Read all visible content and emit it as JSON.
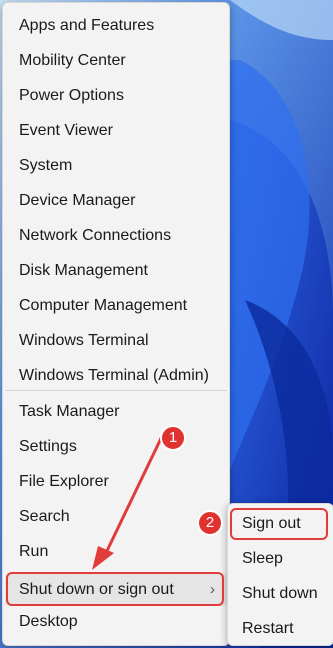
{
  "menu": {
    "items_group1": [
      {
        "name": "menu-item-apps-and-features",
        "label": "Apps and Features"
      },
      {
        "name": "menu-item-mobility-center",
        "label": "Mobility Center"
      },
      {
        "name": "menu-item-power-options",
        "label": "Power Options"
      },
      {
        "name": "menu-item-event-viewer",
        "label": "Event Viewer"
      },
      {
        "name": "menu-item-system",
        "label": "System"
      },
      {
        "name": "menu-item-device-manager",
        "label": "Device Manager"
      },
      {
        "name": "menu-item-network-connections",
        "label": "Network Connections"
      },
      {
        "name": "menu-item-disk-management",
        "label": "Disk Management"
      },
      {
        "name": "menu-item-computer-management",
        "label": "Computer Management"
      },
      {
        "name": "menu-item-windows-terminal",
        "label": "Windows Terminal"
      },
      {
        "name": "menu-item-windows-terminal-admin",
        "label": "Windows Terminal (Admin)"
      }
    ],
    "items_group2": [
      {
        "name": "menu-item-task-manager",
        "label": "Task Manager"
      },
      {
        "name": "menu-item-settings",
        "label": "Settings"
      },
      {
        "name": "menu-item-file-explorer",
        "label": "File Explorer"
      },
      {
        "name": "menu-item-search",
        "label": "Search"
      },
      {
        "name": "menu-item-run",
        "label": "Run"
      },
      {
        "name": "menu-item-shut-down-or-sign-out",
        "label": "Shut down or sign out"
      },
      {
        "name": "menu-item-desktop",
        "label": "Desktop"
      }
    ],
    "chevron_icon": "chevron-right-icon"
  },
  "submenu": {
    "items": [
      {
        "name": "submenu-item-sign-out",
        "label": "Sign out"
      },
      {
        "name": "submenu-item-sleep",
        "label": "Sleep"
      },
      {
        "name": "submenu-item-shut-down",
        "label": "Shut down"
      },
      {
        "name": "submenu-item-restart",
        "label": "Restart"
      }
    ]
  },
  "annotations": {
    "badge1": "1",
    "badge2": "2",
    "accent_color": "#e23b3b"
  }
}
